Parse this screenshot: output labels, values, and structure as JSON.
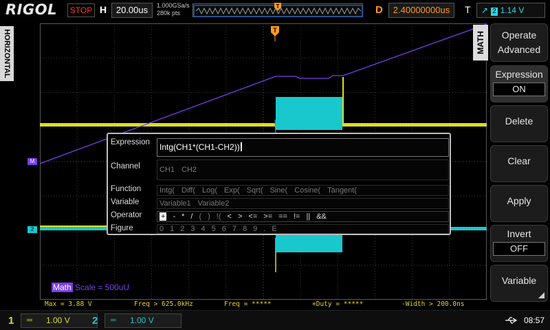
{
  "topbar": {
    "logo": "RIGOL",
    "run_status": "STOP",
    "horizontal_label": "H",
    "timebase": "20.00us",
    "sample_rate": "1.000GSa/s",
    "memory_depth": "280k pts",
    "delay_label": "D",
    "delay": "2.40000000us",
    "trigger_label": "T",
    "trigger_channel": "2",
    "trigger_level": "1.14 V"
  },
  "left_tab": {
    "label": "HORIZONTAL"
  },
  "markers": {
    "math": "M",
    "ch2": "2",
    "trigger": "T"
  },
  "math_scale": {
    "name": "Math",
    "scale": "Scale = 500uU"
  },
  "menu": {
    "tab": "MATH",
    "operate_label": "Operate",
    "operate_value": "Advanced",
    "expression_label": "Expression",
    "expression_state": "ON",
    "delete": "Delete",
    "clear": "Clear",
    "apply": "Apply",
    "invert_label": "Invert",
    "invert_state": "OFF",
    "variable": "Variable"
  },
  "dialog": {
    "expression_label": "Expression",
    "expression_value": "Intg(CH1*(CH1-CH2))",
    "channel_label": "Channel",
    "channel_options": [
      "CH1",
      "CH2"
    ],
    "function_label": "Function",
    "function_options": [
      "Intg(",
      "Diff(",
      "Log(",
      "Exp(",
      "Sqrt(",
      "Sine(",
      "Cosine(",
      "Tangent("
    ],
    "variable_label": "Variable",
    "variable_options": [
      "Variable1",
      "Variable2"
    ],
    "operator_label": "Operator",
    "operator_options": [
      "+",
      "-",
      "*",
      "/",
      "(",
      ")",
      "!(",
      "<",
      ">",
      "<=",
      ">=",
      "==",
      "!=",
      "||",
      "&&"
    ],
    "figure_label": "Figure",
    "figure_options": [
      "0",
      "1",
      "2",
      "3",
      "4",
      "5",
      "6",
      "7",
      "8",
      "9",
      ".",
      "E"
    ]
  },
  "measurements": {
    "max": "Max = 3.88 V",
    "freq1": "Freq > 625.0kHz",
    "freq2": "Freq = *****",
    "duty": "+Duty = *****",
    "width": "-Width > 200.0ns"
  },
  "bottombar": {
    "ch1_number": "1",
    "ch1_scale": "1.00 V",
    "ch2_number": "2",
    "ch2_scale": "1.00 V",
    "time": "08:57"
  },
  "colors": {
    "ch1": "#dede1e",
    "ch2": "#19c8cc",
    "math": "#7b3cf0",
    "trigger": "#ff9a1c",
    "grid": "#3a3a3a"
  }
}
